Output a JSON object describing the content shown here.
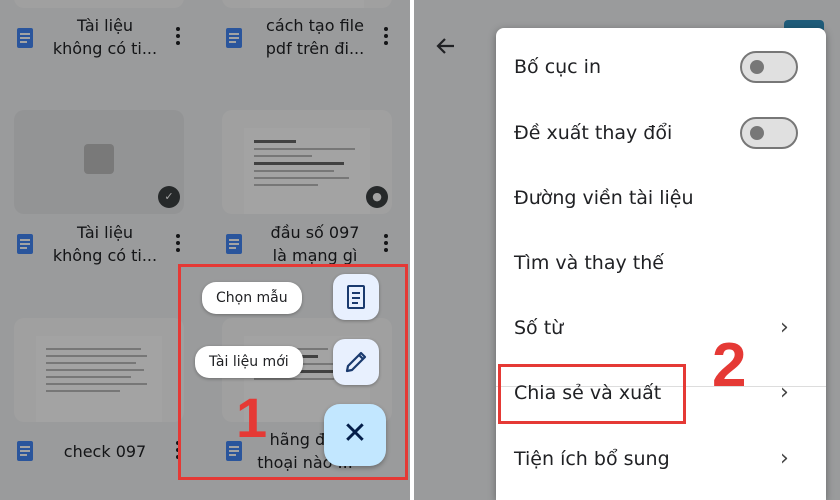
{
  "drive": {
    "files": [
      {
        "line1": "Tài liệu",
        "line2": "không có ti..."
      },
      {
        "line1": "cách tạo file",
        "line2": "pdf trên đi..."
      },
      {
        "line1": "Tài liệu",
        "line2": "không có ti..."
      },
      {
        "line1": "đầu số 097",
        "line2": "là mạng gì"
      },
      {
        "line1": "check 097",
        "line2": ""
      },
      {
        "line1": "hãng đ...",
        "line2": "thoại nào ..."
      }
    ],
    "icons": {
      "doc": "google-docs-icon",
      "more": "more-vert-icon",
      "shared": "shared-people-icon"
    }
  },
  "fab_menu": {
    "template_label": "Chọn mẫu",
    "new_doc_label": "Tài liệu mới",
    "template_icon": "template-doc-icon",
    "new_doc_icon": "pencil-icon",
    "close_icon": "close-icon",
    "close_glyph": "✕"
  },
  "annotations": {
    "step1": "1",
    "step2": "2",
    "color": "#e53935"
  },
  "menu": {
    "back_icon": "arrow-back-icon",
    "items": [
      {
        "label": "Bố cục in",
        "control": "toggle",
        "state": "off"
      },
      {
        "label": "Đề xuất thay đổi",
        "control": "toggle",
        "state": "off"
      },
      {
        "label": "Đường viền tài liệu",
        "control": "none"
      },
      {
        "label": "Tìm và thay thế",
        "control": "none"
      },
      {
        "label": "Số từ",
        "control": "chevron"
      },
      {
        "label": "Chia sẻ và xuất",
        "control": "chevron"
      },
      {
        "label": "Tiện ích bổ sung",
        "control": "chevron"
      }
    ],
    "chevron_glyph": "›"
  },
  "colors": {
    "fab": "#c2e7ff",
    "minifab": "#e8f0fe",
    "doc_blue": "#4285f4",
    "scrim": "rgba(0,0,0,0.36)"
  }
}
